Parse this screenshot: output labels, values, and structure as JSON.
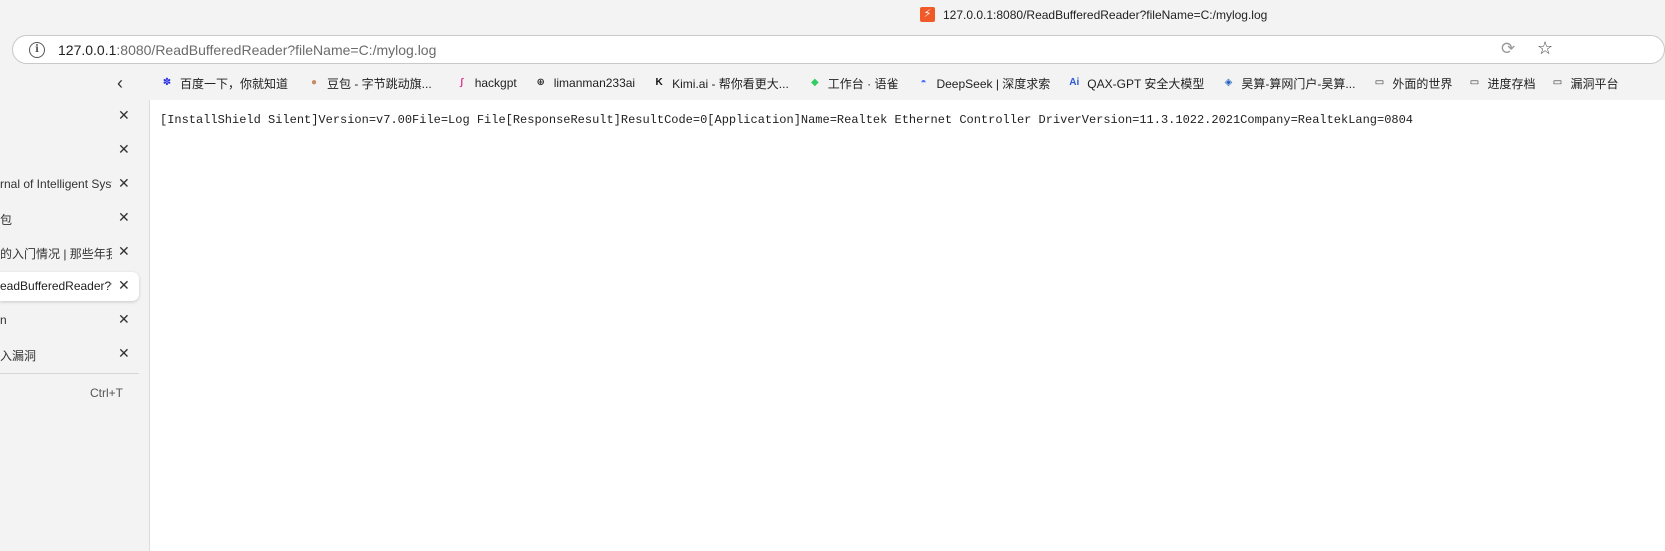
{
  "window": {
    "tab_title": "127.0.0.1:8080/ReadBufferedReader?fileName=C:/mylog.log"
  },
  "address_bar": {
    "url_host": "127.0.0.1",
    "url_rest": ":8080/ReadBufferedReader?fileName=C:/mylog.log"
  },
  "icons": {
    "favicon": "⚡",
    "info": "i",
    "reload": "⟳",
    "star": "☆",
    "collapse": "‹",
    "close": "✕"
  },
  "bookmarks": [
    {
      "label": "百度一下，你就知道",
      "icon": "baidu-icon",
      "color": "#2932e1",
      "glyph": "✽"
    },
    {
      "label": "豆包 - 字节跳动旗...",
      "icon": "doubao-icon",
      "color": "#c38c64",
      "glyph": "●"
    },
    {
      "label": "hackgpt",
      "icon": "hackgpt-icon",
      "color": "#e03a8a",
      "glyph": "∫"
    },
    {
      "label": "limanman233ai",
      "icon": "globe-icon",
      "color": "#333333",
      "glyph": "⊕"
    },
    {
      "label": "Kimi.ai - 帮你看更大...",
      "icon": "kimi-icon",
      "color": "#111111",
      "glyph": "K"
    },
    {
      "label": "工作台 · 语雀",
      "icon": "yuque-icon",
      "color": "#31cc62",
      "glyph": "◆"
    },
    {
      "label": "DeepSeek | 深度求索",
      "icon": "deepseek-icon",
      "color": "#4d6bfe",
      "glyph": "◓"
    },
    {
      "label": "QAX-GPT 安全大模型",
      "icon": "qax-icon",
      "color": "#2a5bd7",
      "glyph": "Ai"
    },
    {
      "label": "昊算-算网门户-昊算...",
      "icon": "haosuan-icon",
      "color": "#1f5fbf",
      "glyph": "◈"
    },
    {
      "label": "外面的世界",
      "icon": "folder-icon",
      "color": "#333333",
      "glyph": "▭"
    },
    {
      "label": "进度存档",
      "icon": "folder-icon",
      "color": "#333333",
      "glyph": "▭"
    },
    {
      "label": "漏洞平台",
      "icon": "folder-icon",
      "color": "#333333",
      "glyph": "▭"
    }
  ],
  "sidebar": {
    "tabs": [
      {
        "label": ""
      },
      {
        "label": ""
      },
      {
        "label": "rnal of Intelligent Syste"
      },
      {
        "label": "包"
      },
      {
        "label": "的入门情况 | 那些年我们"
      },
      {
        "label": "eadBufferedReader?file"
      },
      {
        "label": "n"
      },
      {
        "label": "入漏洞"
      }
    ],
    "new_tab_shortcut": "Ctrl+T"
  },
  "content": {
    "log_text": "[InstallShield Silent]Version=v7.00File=Log File[ResponseResult]ResultCode=0[Application]Name=Realtek Ethernet Controller DriverVersion=11.3.1022.2021Company=RealtekLang=0804"
  }
}
